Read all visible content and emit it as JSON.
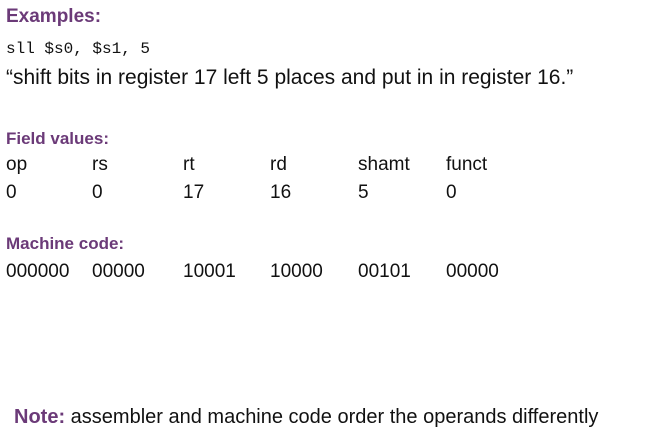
{
  "examples": {
    "heading": "Examples:",
    "code": "sll $s0, $s1, 5",
    "description": "“shift bits in register 17 left 5 places and put in in register 16.”"
  },
  "field_values": {
    "heading": "Field values:",
    "columns": [
      "op",
      "rs",
      "rt",
      "rd",
      "shamt",
      "funct"
    ],
    "values": [
      "0",
      "0",
      "17",
      "16",
      "5",
      "0"
    ]
  },
  "machine_code": {
    "heading": "Machine code:",
    "values": [
      "000000",
      "00000",
      "10001",
      "10000",
      "00101",
      "00000"
    ]
  },
  "note": {
    "label": "Note:",
    "text": " assembler and machine code order the operands differently"
  },
  "colors": {
    "heading": "#6b3a78",
    "text": "#111111",
    "background": "#ffffff"
  }
}
